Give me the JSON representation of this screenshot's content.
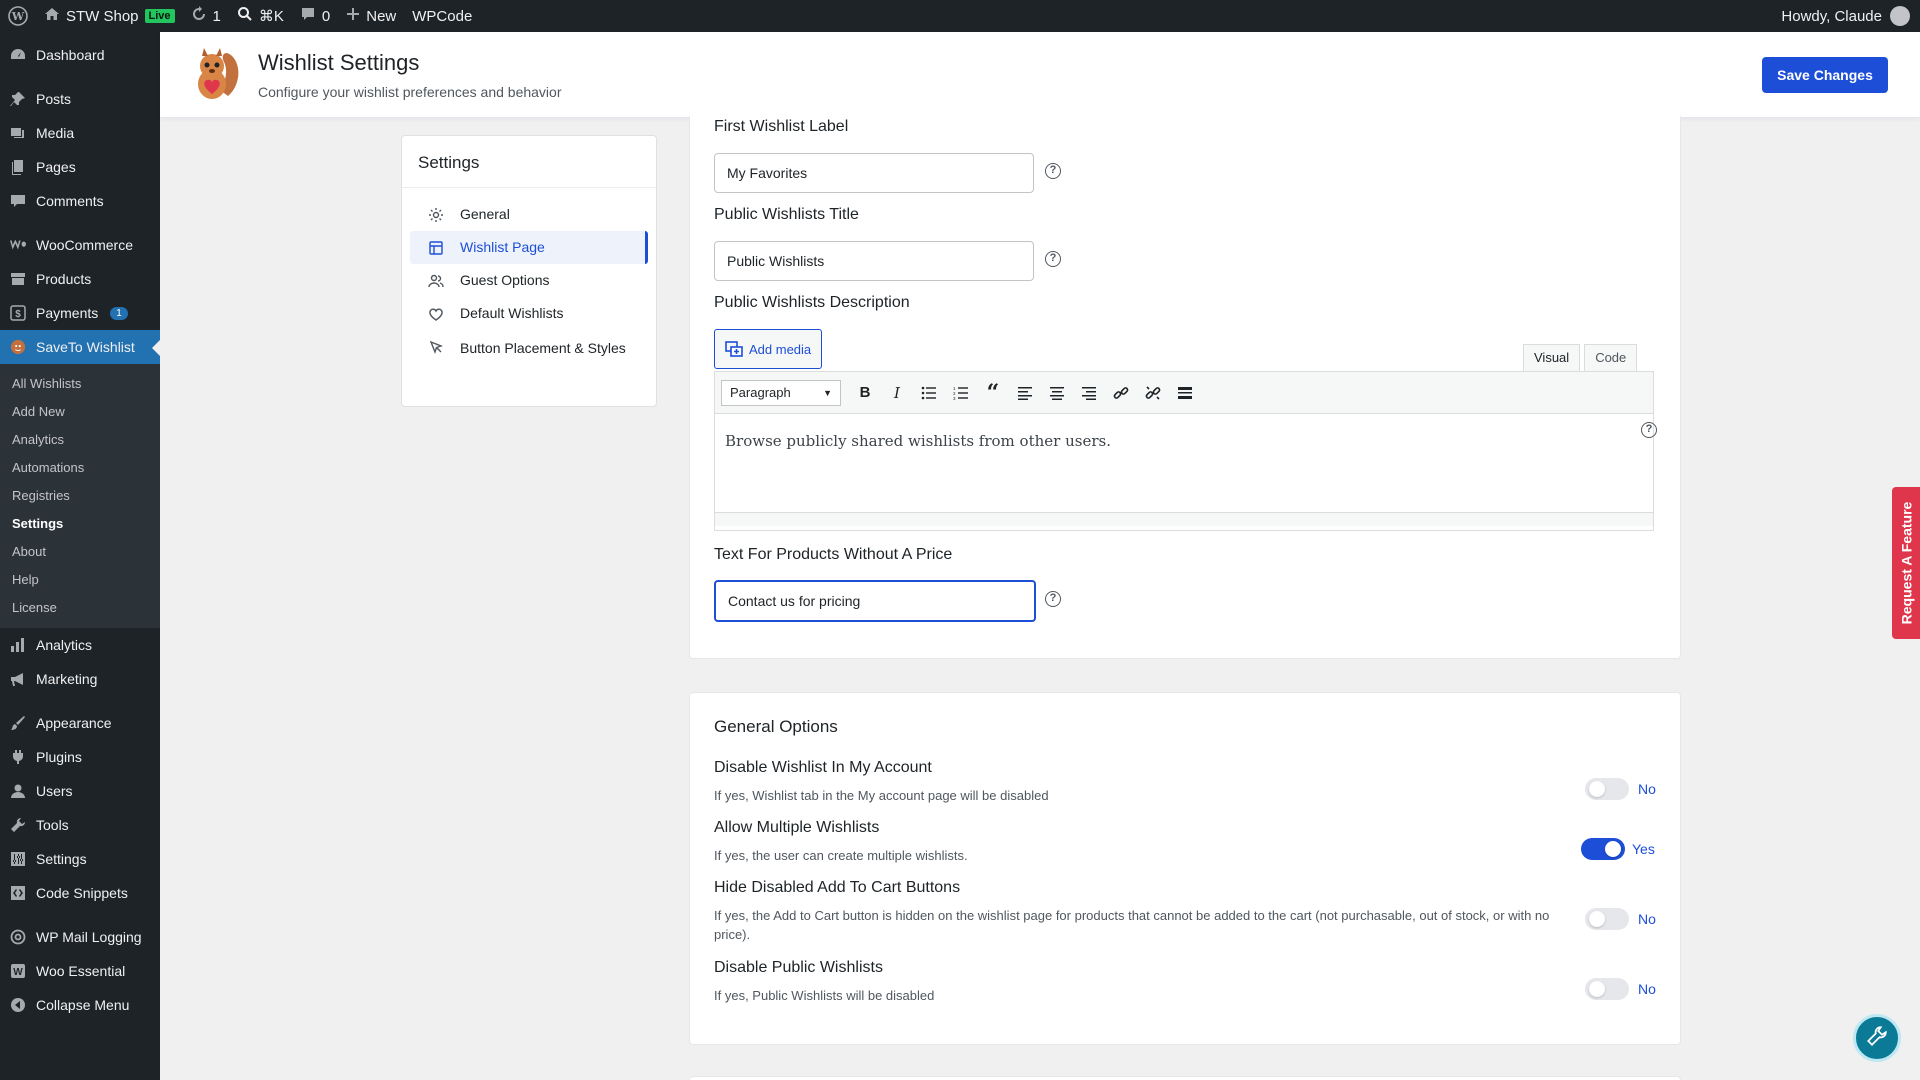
{
  "adminbar": {
    "site_name": "STW Shop",
    "live_badge": "Live",
    "updates_count": "1",
    "search_shortcut": "⌘K",
    "comments_count": "0",
    "new_label": "New",
    "wpcode_label": "WPCode",
    "howdy": "Howdy, Claude"
  },
  "sidebar": {
    "dashboard": "Dashboard",
    "posts": "Posts",
    "media": "Media",
    "pages": "Pages",
    "comments": "Comments",
    "woocommerce": "WooCommerce",
    "products": "Products",
    "payments": "Payments",
    "payments_badge": "1",
    "saveto": "SaveTo Wishlist",
    "submenu": [
      "All Wishlists",
      "Add New",
      "Analytics",
      "Automations",
      "Registries",
      "Settings",
      "About",
      "Help",
      "License"
    ],
    "analytics": "Analytics",
    "marketing": "Marketing",
    "appearance": "Appearance",
    "plugins": "Plugins",
    "users": "Users",
    "tools": "Tools",
    "settings": "Settings",
    "code_snippets": "Code Snippets",
    "wp_mail_logging": "WP Mail Logging",
    "woo_essential": "Woo Essential",
    "collapse": "Collapse Menu"
  },
  "header": {
    "title": "Wishlist Settings",
    "subtitle": "Configure your wishlist preferences and behavior",
    "save_label": "Save Changes"
  },
  "settings_nav": {
    "title": "Settings",
    "items": [
      "General",
      "Wishlist Page",
      "Guest Options",
      "Default Wishlists",
      "Button Placement & Styles"
    ],
    "active": "Wishlist Page"
  },
  "fields": {
    "first_label": {
      "label": "First Wishlist Label",
      "value": "My Favorites"
    },
    "public_title": {
      "label": "Public Wishlists Title",
      "value": "Public Wishlists"
    },
    "public_desc": {
      "label": "Public Wishlists Description",
      "content": "Browse publicly shared wishlists from other users."
    },
    "no_price": {
      "label": "Text For Products Without A Price",
      "value": "Contact us for pricing"
    }
  },
  "editor": {
    "add_media": "Add media",
    "tab_visual": "Visual",
    "tab_code": "Code",
    "format": "Paragraph"
  },
  "general_options": {
    "title": "General Options",
    "options": [
      {
        "title": "Disable Wishlist In My Account",
        "desc": "If yes, Wishlist tab in the My account page will be disabled",
        "state": "No"
      },
      {
        "title": "Allow Multiple Wishlists",
        "desc": "If yes, the user can create multiple wishlists.",
        "state": "Yes"
      },
      {
        "title": "Hide Disabled Add To Cart Buttons",
        "desc": "If yes, the Add to Cart button is hidden on the wishlist page for products that cannot be added to the cart (not purchasable, out of stock, or with no price).",
        "state": "No"
      },
      {
        "title": "Disable Public Wishlists",
        "desc": "If yes, Public Wishlists will be disabled",
        "state": "No"
      }
    ]
  },
  "request_feature": "Request A Feature",
  "colors": {
    "accent": "#1d4ed8",
    "wp_blue": "#2271b1",
    "admin_dark": "#1d2327",
    "request_red": "#e0364b"
  }
}
